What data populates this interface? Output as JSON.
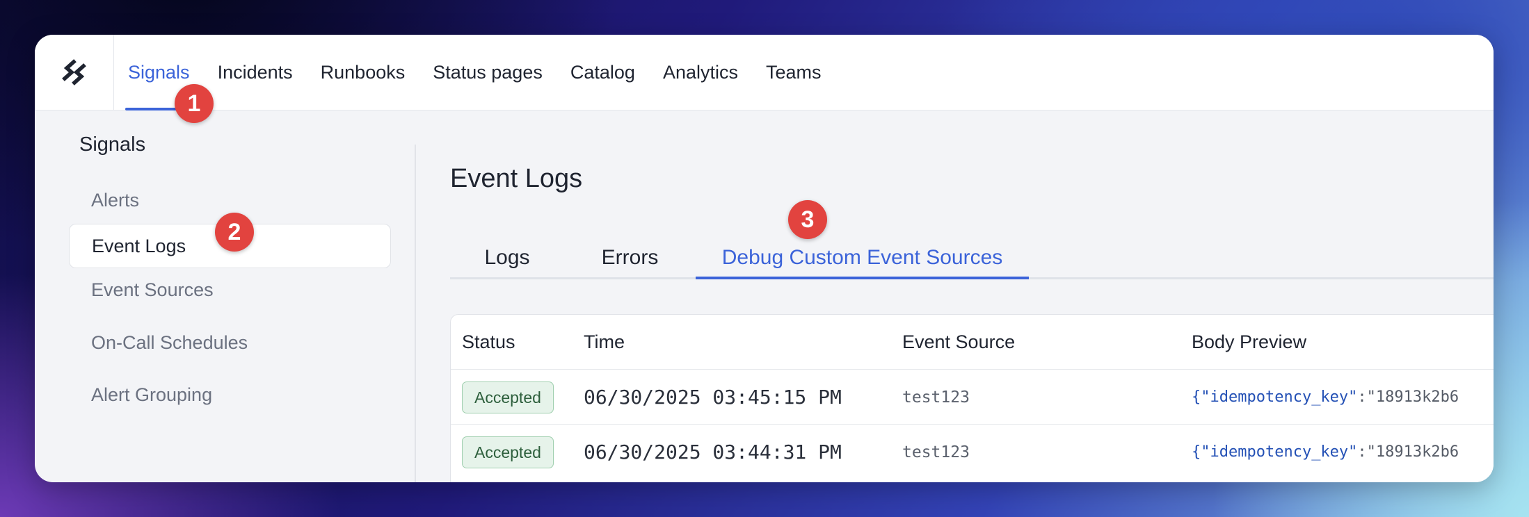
{
  "nav": {
    "items": [
      {
        "label": "Signals",
        "active": true
      },
      {
        "label": "Incidents"
      },
      {
        "label": "Runbooks"
      },
      {
        "label": "Status pages"
      },
      {
        "label": "Catalog"
      },
      {
        "label": "Analytics"
      },
      {
        "label": "Teams"
      }
    ]
  },
  "badges": [
    "1",
    "2",
    "3"
  ],
  "sidebar": {
    "title": "Signals",
    "items": [
      {
        "label": "Alerts"
      },
      {
        "label": "Event Logs",
        "active": true
      },
      {
        "label": "Event Sources"
      },
      {
        "label": "On-Call Schedules"
      },
      {
        "label": "Alert Grouping"
      }
    ]
  },
  "main": {
    "title": "Event Logs",
    "tabs": [
      {
        "label": "Logs"
      },
      {
        "label": "Errors"
      },
      {
        "label": "Debug Custom Event Sources",
        "active": true
      }
    ],
    "table": {
      "headers": [
        "Status",
        "Time",
        "Event Source",
        "Body Preview"
      ],
      "rows": [
        {
          "status": "Accepted",
          "time": "06/30/2025 03:45:15 PM",
          "source": "test123",
          "body_open": "{",
          "body_key": "\"idempotency_key\"",
          "body_sep": ":",
          "body_value": "\"18913k2b6"
        },
        {
          "status": "Accepted",
          "time": "06/30/2025 03:44:31 PM",
          "source": "test123",
          "body_open": "{",
          "body_key": "\"idempotency_key\"",
          "body_sep": ":",
          "body_value": "\"18913k2b6"
        }
      ]
    }
  },
  "colors": {
    "accent": "#3b63d9",
    "badge": "#e2433f",
    "status_accepted_bg": "#e6f3ea",
    "status_accepted_text": "#2d5f3c"
  }
}
